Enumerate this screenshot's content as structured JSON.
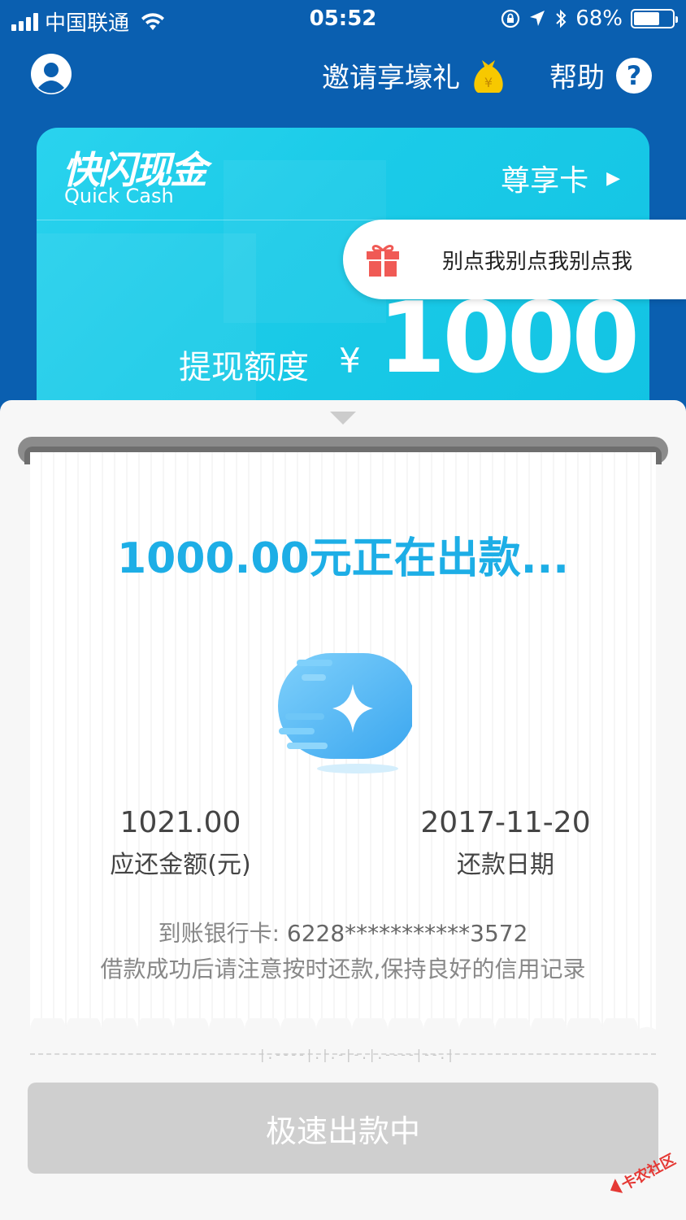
{
  "status_bar": {
    "carrier": "中国联通",
    "time": "05:52",
    "battery": "68%",
    "battery_level": 0.68
  },
  "header": {
    "invite_label": "邀请享壕礼",
    "help_label": "帮助",
    "help_icon": "?"
  },
  "card": {
    "brand_cn": "快闪现金",
    "brand_en": "Quick Cash",
    "vip_label": "尊享卡",
    "vip_arrow": "▶",
    "limit_label": "提现额度",
    "currency": "¥",
    "limit_amount": "1000"
  },
  "gift_popup": {
    "text": "别点我别点我别点我"
  },
  "receipt": {
    "processing_text": "1000.00元正在出款...",
    "due_amount": "1021.00",
    "due_amount_label": "应还金额(元)",
    "due_date": "2017-11-20",
    "due_date_label": "还款日期",
    "bank_card_label": "到账银行卡:",
    "bank_card_number": "6228***********3572",
    "reminder": "借款成功后请注意按时还款,保持良好的信用记录"
  },
  "tear_marks": "|.----|.|.-|-.|.----|--.|",
  "cta_label": "极速出款中",
  "watermark": "卡农社区",
  "colors": {
    "background": "#0a5fb0",
    "card": "#1bcbe8",
    "accent": "#1daee6",
    "button_disabled": "#cfcfcf"
  }
}
